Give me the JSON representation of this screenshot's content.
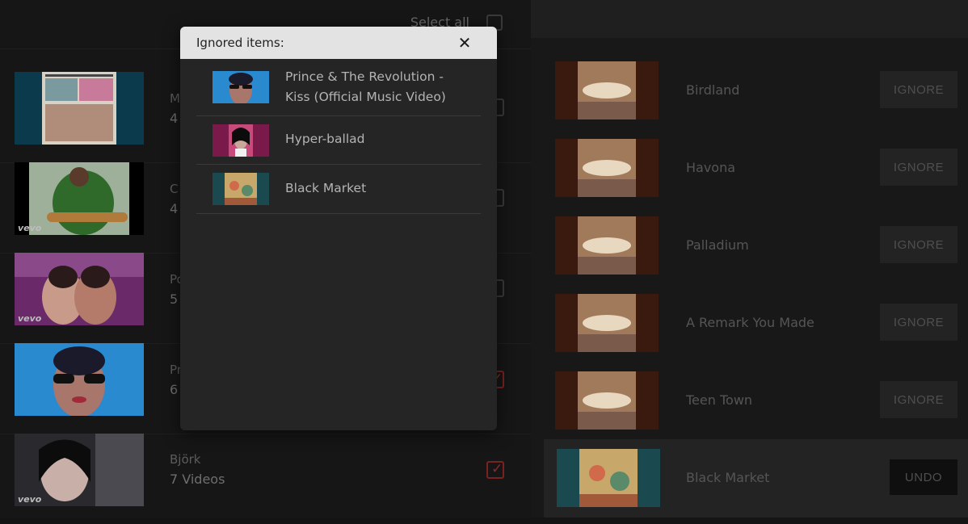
{
  "left_pane": {
    "select_all_label": "Select all",
    "artists": [
      {
        "name": "M",
        "count": "4",
        "checked": false,
        "vevo": false
      },
      {
        "name": "C",
        "count": "4",
        "checked": false,
        "vevo": true
      },
      {
        "name": "Po",
        "count": "5",
        "checked": false,
        "vevo": true
      },
      {
        "name": "Pr",
        "count": "6",
        "checked": true,
        "vevo": false
      },
      {
        "name": "Björk",
        "count": "7 Videos",
        "checked": true,
        "vevo": true
      }
    ],
    "vevo_label": "vevo",
    "check_mark": "✓"
  },
  "right_pane": {
    "tracks": [
      {
        "title": "Birdland",
        "button": "IGNORE",
        "ignored": false
      },
      {
        "title": "Havona",
        "button": "IGNORE",
        "ignored": false
      },
      {
        "title": "Palladium",
        "button": "IGNORE",
        "ignored": false
      },
      {
        "title": "A Remark You Made",
        "button": "IGNORE",
        "ignored": false
      },
      {
        "title": "Teen Town",
        "button": "IGNORE",
        "ignored": false
      },
      {
        "title": "Black Market",
        "button": "UNDO",
        "ignored": true
      }
    ]
  },
  "modal": {
    "title": "Ignored items:",
    "close_icon": "✕",
    "items": [
      {
        "title": "Prince & The Revolution - Kiss (Official Music Video)"
      },
      {
        "title": "Hyper-ballad"
      },
      {
        "title": "Black Market"
      }
    ]
  },
  "colors": {
    "background": "#141414",
    "modal_header": "#e3e3e3",
    "modal_body": "#252525",
    "checkbox_checked": "#8c2a2a"
  }
}
